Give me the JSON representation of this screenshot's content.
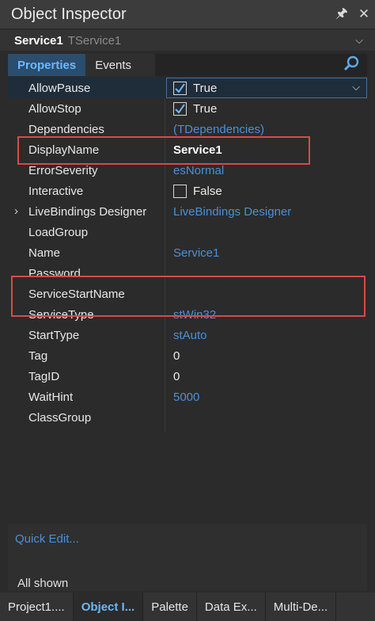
{
  "window": {
    "title": "Object Inspector"
  },
  "component": {
    "name": "Service1",
    "type": "TService1"
  },
  "tabs": [
    {
      "label": "Properties"
    },
    {
      "label": "Events"
    }
  ],
  "properties": [
    {
      "name": "AllowPause",
      "value": "True",
      "checkbox": "checked"
    },
    {
      "name": "AllowStop",
      "value": "True",
      "checkbox": "checked"
    },
    {
      "name": "Dependencies",
      "value": "(TDependencies)"
    },
    {
      "name": "DisplayName",
      "value": "Service1"
    },
    {
      "name": "ErrorSeverity",
      "value": "esNormal"
    },
    {
      "name": "Interactive",
      "value": "False",
      "checkbox": "unchecked"
    },
    {
      "name": "LiveBindings Designer",
      "value": "LiveBindings Designer",
      "expandable": true
    },
    {
      "name": "LoadGroup",
      "value": ""
    },
    {
      "name": "Name",
      "value": "Service1"
    },
    {
      "name": "Password",
      "value": ""
    },
    {
      "name": "ServiceStartName",
      "value": ""
    },
    {
      "name": "ServiceType",
      "value": "stWin32"
    },
    {
      "name": "StartType",
      "value": "stAuto"
    },
    {
      "name": "Tag",
      "value": "0"
    },
    {
      "name": "TagID",
      "value": "0"
    },
    {
      "name": "WaitHint",
      "value": "5000"
    },
    {
      "name": "ClassGroup",
      "value": ""
    }
  ],
  "quick_edit": "Quick Edit...",
  "status": "All shown",
  "bottom_tabs": [
    {
      "label": "Project1...."
    },
    {
      "label": "Object I..."
    },
    {
      "label": "Palette"
    },
    {
      "label": "Data Ex..."
    },
    {
      "label": "Multi-De..."
    }
  ],
  "colors": {
    "accent": "#4c8fd6",
    "highlight_box": "#d94a4a",
    "selected_row": "#1f2d3b"
  }
}
